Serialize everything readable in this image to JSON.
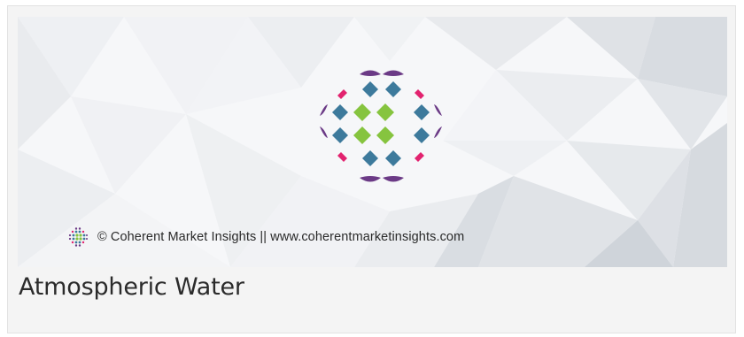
{
  "banner": {
    "copyright_text": "© Coherent Market Insights || www.coherentmarketinsights.com",
    "logo_icon": "coherent-market-insights-logo-icon",
    "colors": {
      "purple": "#6b3a86",
      "pink": "#e2236f",
      "teal": "#3d7a9c",
      "green": "#86c43f",
      "background": "#f4f4f4"
    }
  },
  "article": {
    "title": "Atmospheric Water"
  }
}
